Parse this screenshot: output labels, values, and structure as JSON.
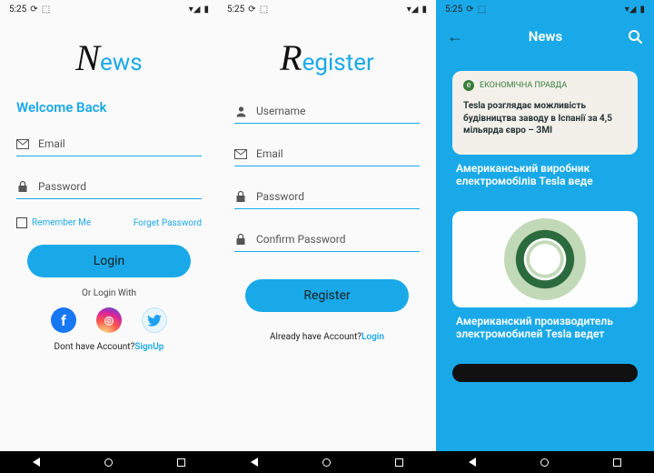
{
  "status": {
    "time": "5:25",
    "icons_left": "⟳ ⬚",
    "icons_right": "◢◣ ▮"
  },
  "screen1": {
    "brand_cap": "N",
    "brand_rest": "ews",
    "welcome": "Welcome Back",
    "email": "Email",
    "password": "Password",
    "remember": "Remember Me",
    "forgot": "Forget Password",
    "login_btn": "Login",
    "or_with": "Or Login With",
    "no_account": "Dont have Account?",
    "signup": "SignUp"
  },
  "screen2": {
    "brand_cap": "R",
    "brand_rest": "egister",
    "username": "Username",
    "email": "Email",
    "password": "Password",
    "confirm": "Confirm Password",
    "register_btn": "Register",
    "already": "Already have Account?",
    "login": "Login"
  },
  "screen3": {
    "title": "News",
    "card1": {
      "source": "ЕКОНОМІЧНА ПРАВДА",
      "headline": "Tesla розглядає можливість будівництва заводу в Іспанії за 4,5 мільярда євро – ЗМІ",
      "caption": "Американський виробник електромобілів Tesla веде"
    },
    "card2": {
      "caption": "Американский производитель электромобилей Tesla ведет"
    }
  }
}
